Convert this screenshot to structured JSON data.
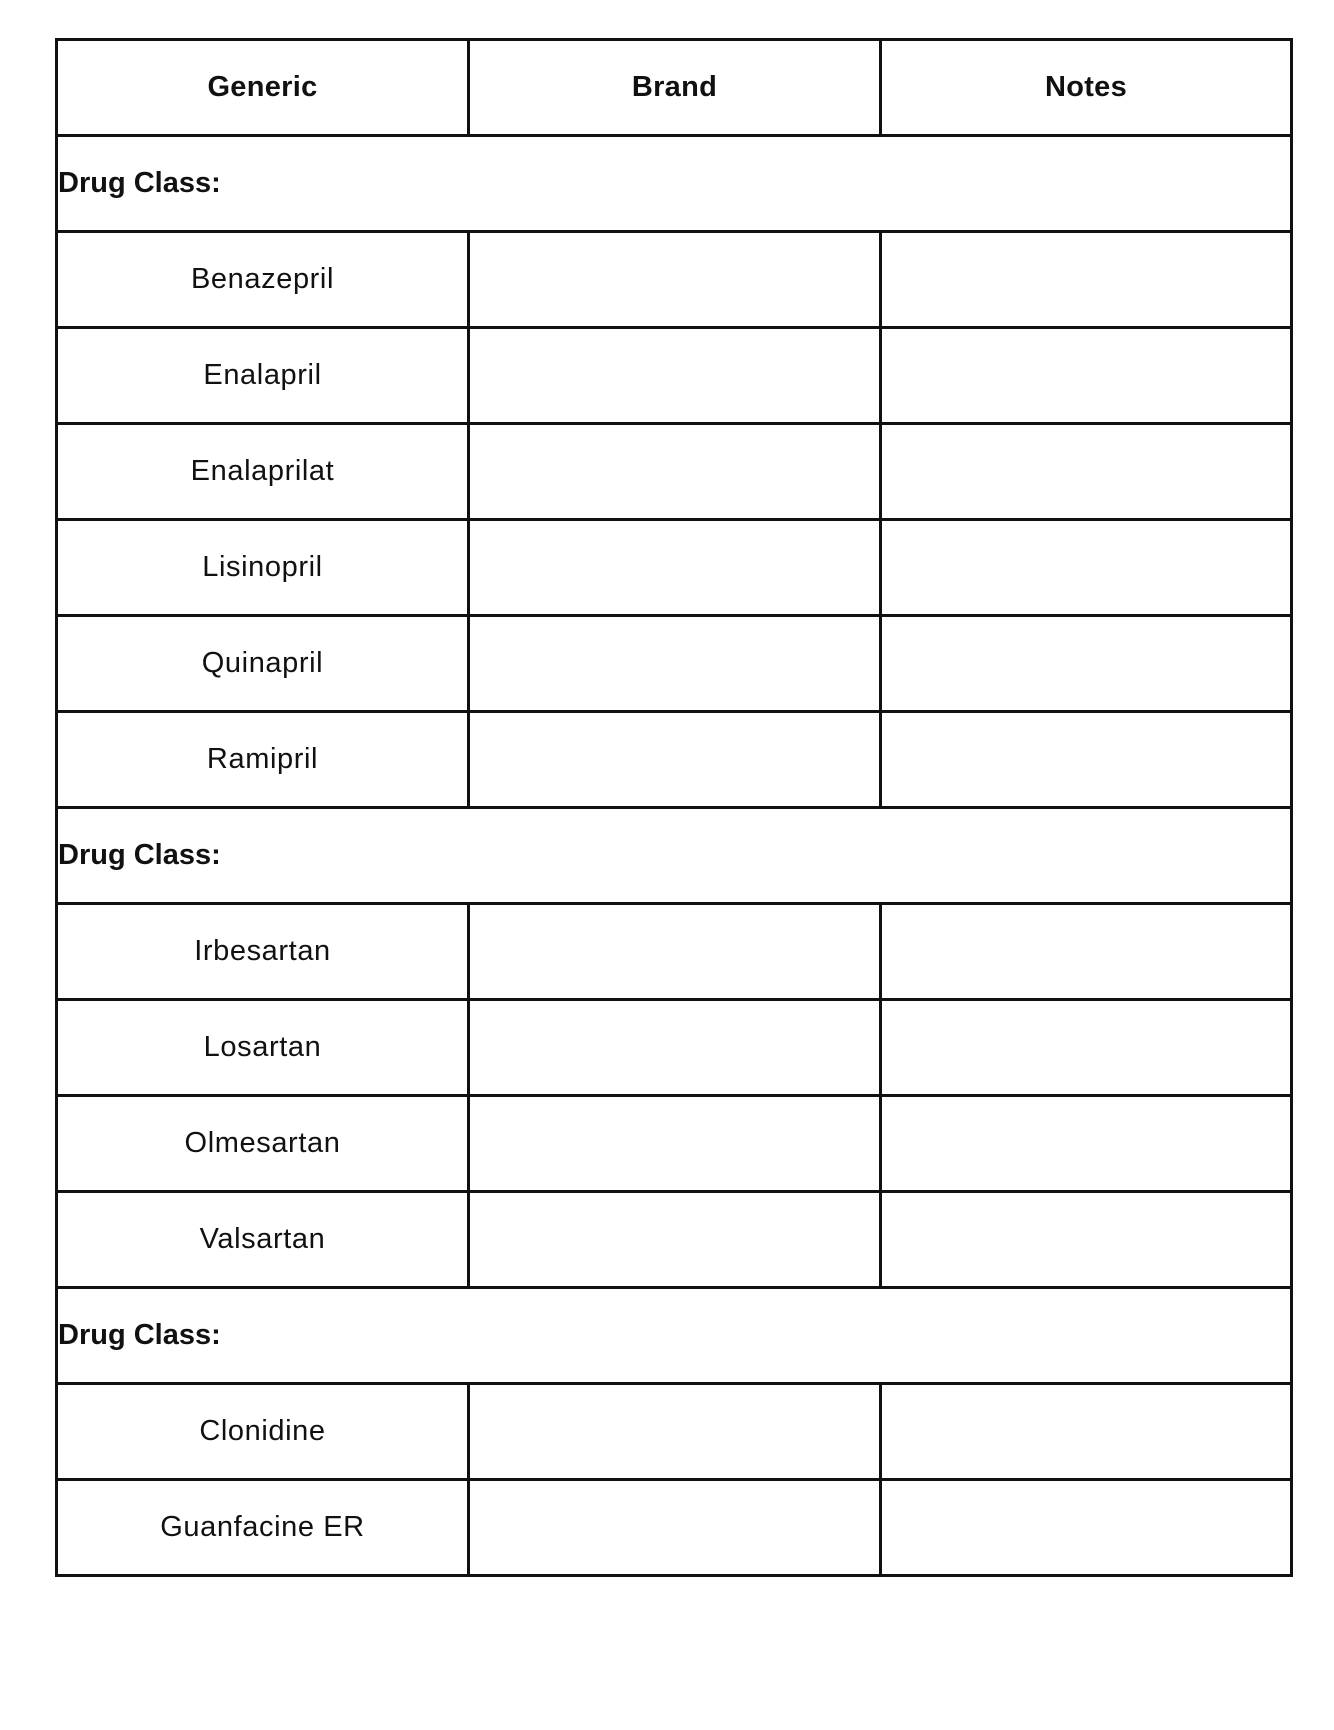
{
  "table": {
    "headers": {
      "generic": "Generic",
      "brand": "Brand",
      "notes": "Notes"
    },
    "sections": [
      {
        "class_label": "Drug Class:",
        "drugs": [
          {
            "generic": "Benazepril",
            "brand": "",
            "notes": ""
          },
          {
            "generic": "Enalapril",
            "brand": "",
            "notes": ""
          },
          {
            "generic": "Enalaprilat",
            "brand": "",
            "notes": ""
          },
          {
            "generic": "Lisinopril",
            "brand": "",
            "notes": ""
          },
          {
            "generic": "Quinapril",
            "brand": "",
            "notes": ""
          },
          {
            "generic": "Ramipril",
            "brand": "",
            "notes": ""
          }
        ]
      },
      {
        "class_label": "Drug Class:",
        "drugs": [
          {
            "generic": "Irbesartan",
            "brand": "",
            "notes": ""
          },
          {
            "generic": "Losartan",
            "brand": "",
            "notes": ""
          },
          {
            "generic": "Olmesartan",
            "brand": "",
            "notes": ""
          },
          {
            "generic": "Valsartan",
            "brand": "",
            "notes": ""
          }
        ]
      },
      {
        "class_label": "Drug Class:",
        "drugs": [
          {
            "generic": "Clonidine",
            "brand": "",
            "notes": ""
          },
          {
            "generic": "Guanfacine ER",
            "brand": "",
            "notes": ""
          }
        ]
      }
    ]
  }
}
